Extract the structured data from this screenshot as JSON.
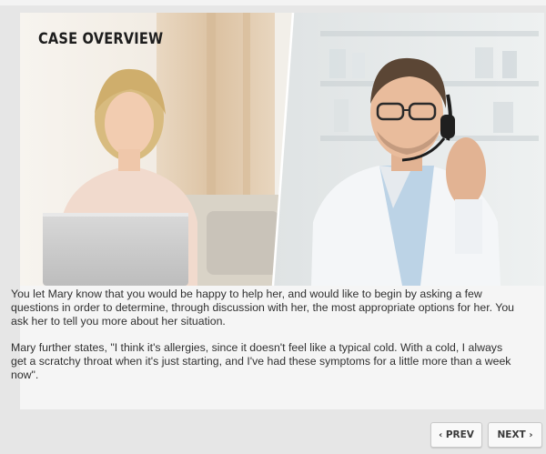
{
  "slide": {
    "title": "CASE OVERVIEW",
    "paragraphs": [
      "You let Mary know that you would be happy to help her, and would like to begin by asking a few questions in order to determine, through discussion with her, the most appropriate options for her. You ask her to tell you more about her situation.",
      "Mary further states, \"I think it's allergies, since it doesn't feel  like a typical cold.  With a cold, I always get a scratchy throat  when it's just starting, and I've had these symptoms for a little more than a week now\"."
    ]
  },
  "navigation": {
    "prev": {
      "icon": "chevron-left-icon",
      "glyph": "‹",
      "label": "PREV"
    },
    "next": {
      "icon": "chevron-right-icon",
      "glyph": "›",
      "label": "NEXT"
    }
  },
  "colors": {
    "background": "#e6e6e6",
    "panel": "#f5f5f5",
    "text": "#303030",
    "pharmacist_coat": "#f4f6f8",
    "shirt": "#bcd3e6"
  }
}
